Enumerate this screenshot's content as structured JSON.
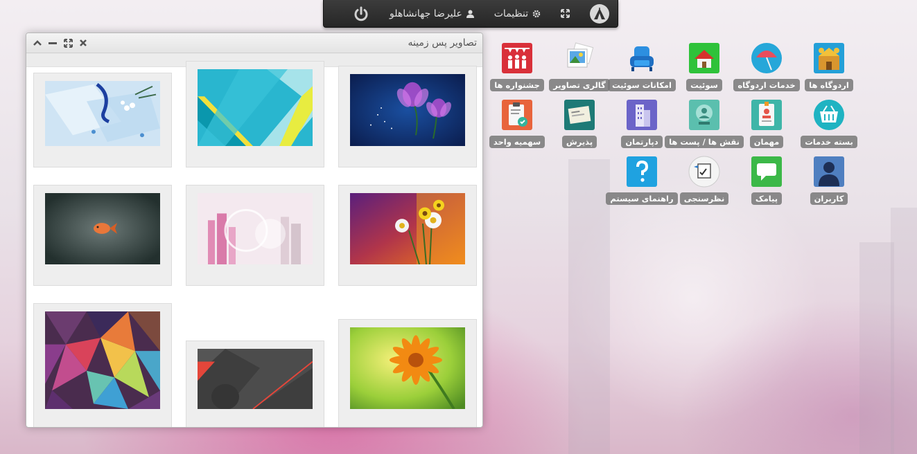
{
  "taskbar": {
    "settings_label": "تنظیمات",
    "user_label": "علیرضا جهانشاهلو"
  },
  "window": {
    "title": "تصاویر پس زمینه"
  },
  "wallpapers": [
    {
      "name": "glass-blue-flowers"
    },
    {
      "name": "teal-material"
    },
    {
      "name": "purple-flowers-dark-blue"
    },
    {
      "name": "goldfish-dark"
    },
    {
      "name": "pink-abstract-city"
    },
    {
      "name": "daisies-colorful"
    },
    {
      "name": "low-poly-colorful"
    },
    {
      "name": "dark-material-red-line"
    },
    {
      "name": "orange-gerbera"
    }
  ],
  "desktop": {
    "icons": [
      {
        "key": "camps",
        "label": "اردوگاه ها",
        "icon": "camps-icon"
      },
      {
        "key": "camp_services",
        "label": "خدمات اردوگاه",
        "icon": "umbrella-icon"
      },
      {
        "key": "suite",
        "label": "سوئیت",
        "icon": "house-icon"
      },
      {
        "key": "suite_facilities",
        "label": "امکانات سوئیت",
        "icon": "armchair-icon"
      },
      {
        "key": "gallery",
        "label": "گالری تصاویر",
        "icon": "photos-icon"
      },
      {
        "key": "festivals",
        "label": "جشنواره ها",
        "icon": "crowd-icon"
      },
      {
        "key": "service_package",
        "label": "بسته خدمات",
        "icon": "basket-icon"
      },
      {
        "key": "guest",
        "label": "مهمان",
        "icon": "id-badge-icon"
      },
      {
        "key": "roles",
        "label": "نقش ها / پست ها",
        "icon": "role-icon"
      },
      {
        "key": "department",
        "label": "دپارتمان",
        "icon": "building-icon"
      },
      {
        "key": "reception",
        "label": "پذیرش",
        "icon": "reception-card-icon"
      },
      {
        "key": "unit_quota",
        "label": "سهمیه واحد",
        "icon": "clipboard-check-icon"
      },
      {
        "key": "users",
        "label": "کاربران",
        "icon": "user-icon"
      },
      {
        "key": "sms",
        "label": "پیامک",
        "icon": "message-icon"
      },
      {
        "key": "survey",
        "label": "نظرسنجی",
        "icon": "survey-icon"
      },
      {
        "key": "help",
        "label": "راهنمای سیستم",
        "icon": "help-icon"
      }
    ]
  },
  "colors": {
    "taskbar": "#2e2e2e",
    "label_bg": "#7b7b7b",
    "window_header": "#e8e8e8"
  }
}
